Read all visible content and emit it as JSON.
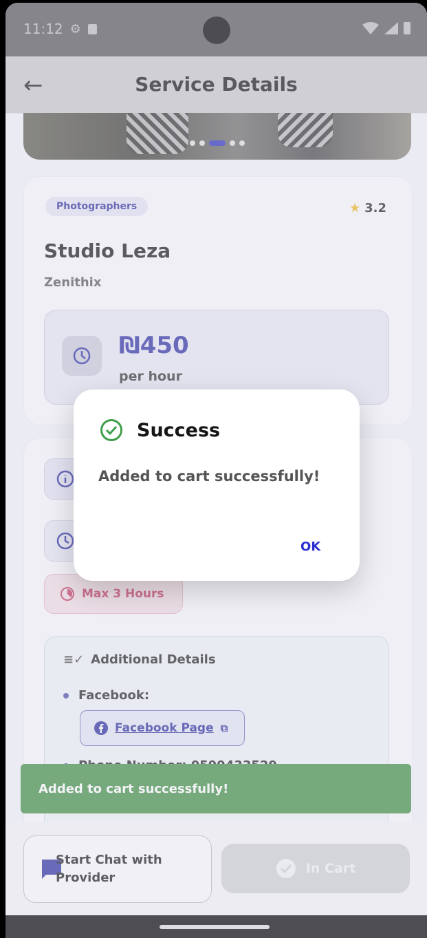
{
  "status_bar": {
    "time": "11:12"
  },
  "app_bar": {
    "title": "Service Details"
  },
  "service": {
    "category": "Photographers",
    "rating": "3.2",
    "name": "Studio Leza",
    "provider": "Zenithix",
    "price": "₪450",
    "price_unit": "per hour"
  },
  "details": {
    "max_hours": "Max 3 Hours",
    "additional_title": "Additional Details",
    "facebook_label": "Facebook:",
    "facebook_link": "Facebook Page",
    "phone_label": "Phone Number: 0599433529"
  },
  "snackbar": {
    "message": "Added to cart successfully!"
  },
  "bottom": {
    "chat_line1": "Start Chat with",
    "chat_line2": "Provider",
    "cart_label": "In Cart"
  },
  "dialog": {
    "title": "Success",
    "message": "Added to cart successfully!",
    "ok": "OK"
  },
  "colors": {
    "accent": "#2b2ed0",
    "success": "#3f8e3f",
    "star": "#f2b51c",
    "max_hours": "#c2395c"
  },
  "hero_carousel": {
    "page_count": 5,
    "active_page": 3
  }
}
